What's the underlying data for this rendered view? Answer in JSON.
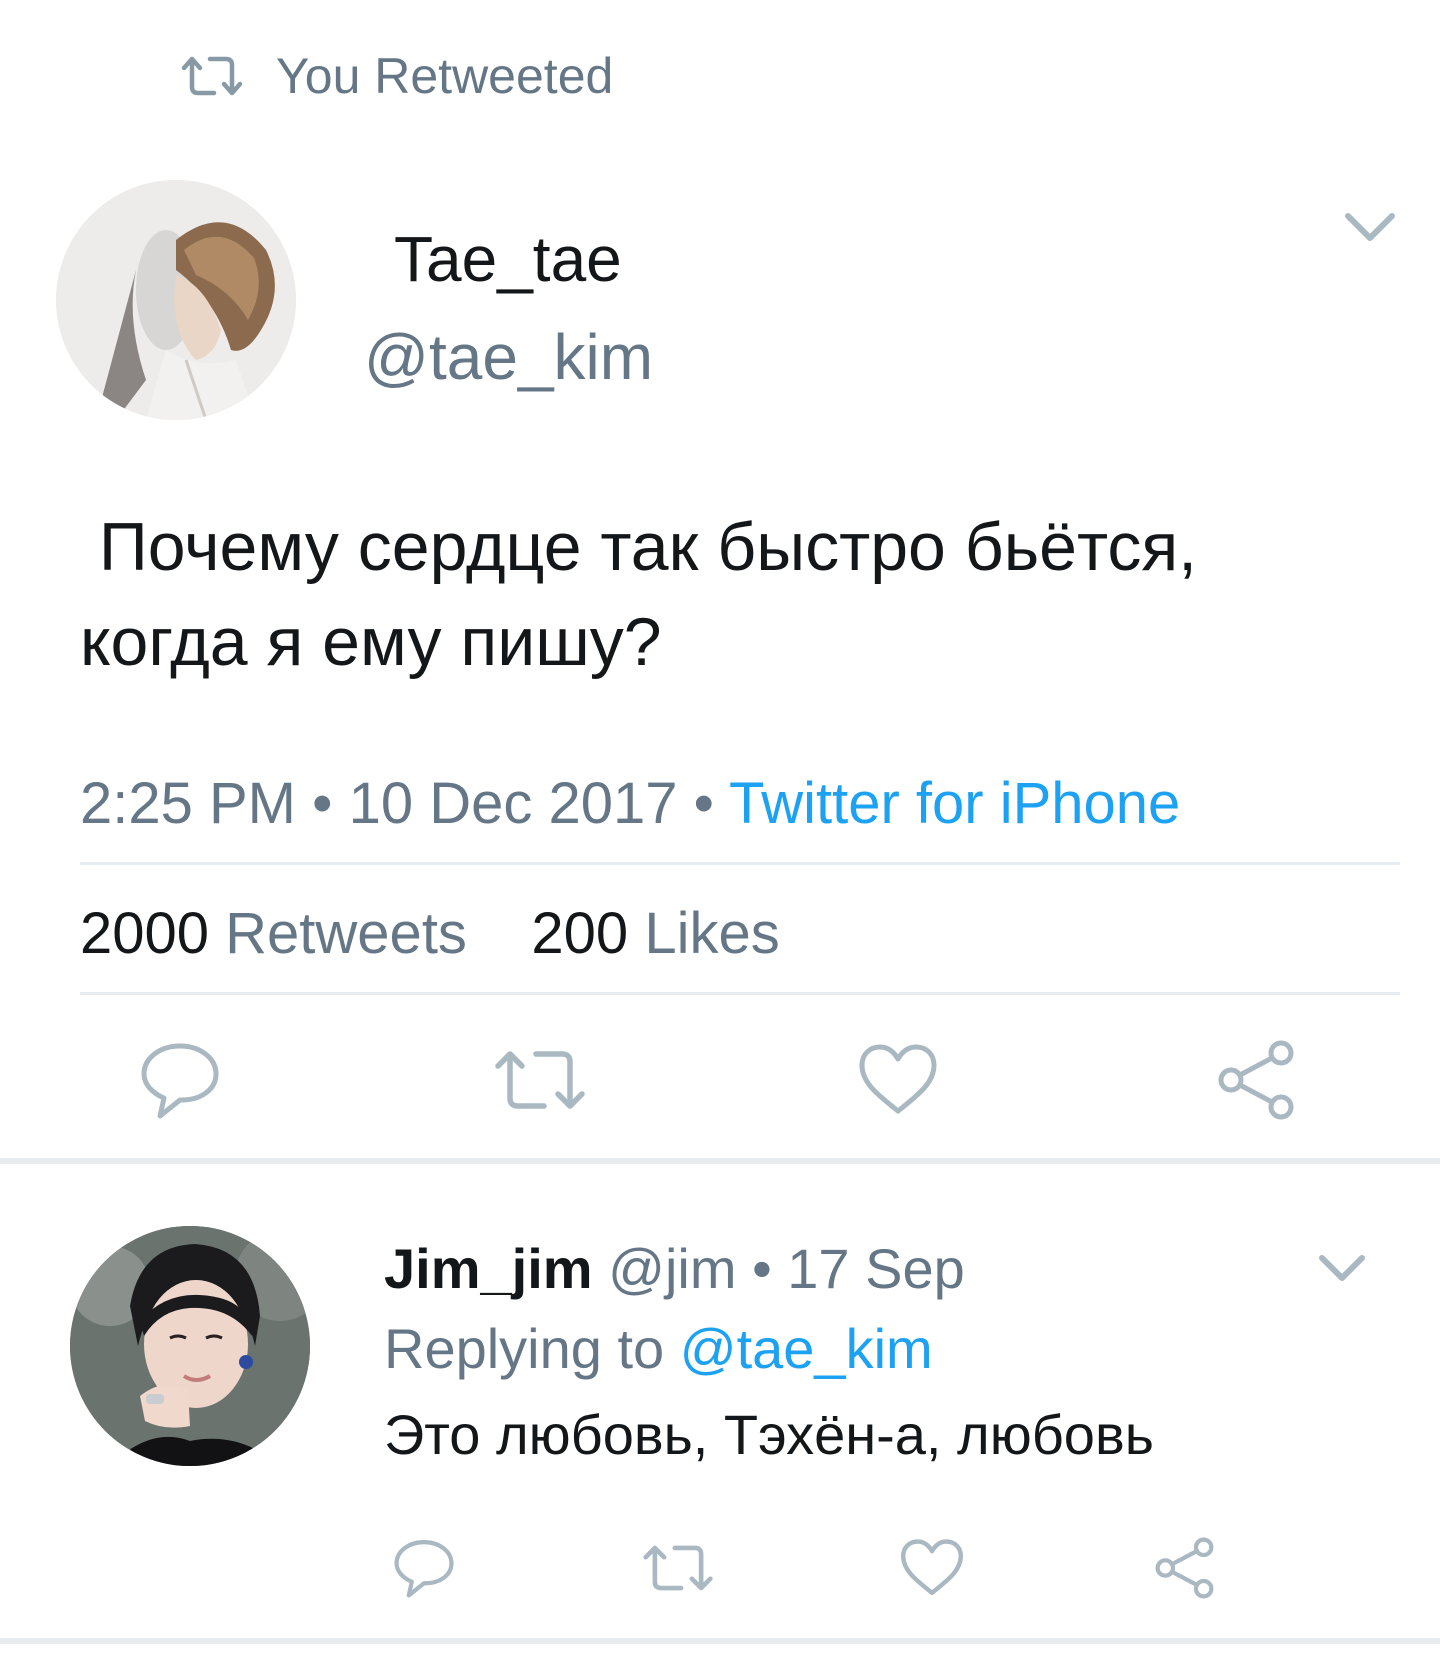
{
  "context": {
    "label": "You Retweeted",
    "icon": "retweet-icon"
  },
  "tweet": {
    "author_name": "Tae_tae",
    "author_handle": "@tae_kim",
    "text": " Почему сердце так быстро бьётся,\nкогда я ему пишу?",
    "time": "2:25 PM",
    "date": "10 Dec 2017",
    "source": "Twitter for iPhone",
    "separator": "•",
    "retweets_count": "2000",
    "retweets_label": "Retweets",
    "likes_count": "200",
    "likes_label": "Likes"
  },
  "reply": {
    "author_name": "Jim_jim",
    "author_handle": "@jim",
    "separator": "•",
    "date": "17 Sep",
    "replying_to_label": "Replying to",
    "replying_to_handle": "@tae_kim",
    "text": "Это любовь, Тэхён-а, любовь"
  },
  "actions": [
    "reply-icon",
    "retweet-icon",
    "like-icon",
    "share-icon"
  ],
  "colors": {
    "text_primary": "#14171a",
    "text_secondary": "#657786",
    "accent": "#1da1f2",
    "icon": "#aab8c2",
    "divider": "#e6ecf0"
  }
}
